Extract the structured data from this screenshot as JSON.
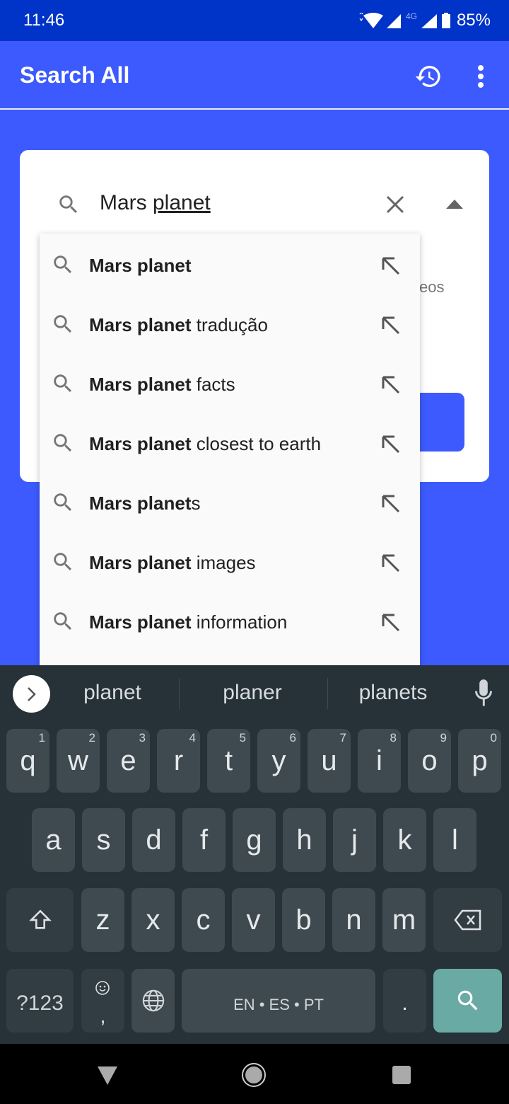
{
  "status_bar": {
    "time": "11:46",
    "network": "4G",
    "battery": "85%"
  },
  "app_bar": {
    "title": "Search All",
    "history_icon": "history-icon",
    "menu_icon": "more-vert-icon"
  },
  "search": {
    "query_plain": "Mars ",
    "query_composing": "planet",
    "clear_icon": "close-icon",
    "collapse_icon": "arrow-up-icon"
  },
  "card_partial_text": "eos",
  "suggestions": [
    {
      "bold": "Mars planet",
      "rest": ""
    },
    {
      "bold": "Mars planet",
      "rest": " tradução"
    },
    {
      "bold": "Mars planet",
      "rest": " facts"
    },
    {
      "bold": "Mars planet",
      "rest": " closest to earth"
    },
    {
      "bold": "Mars planet",
      "rest": "s"
    },
    {
      "bold": "Mars planet",
      "rest": " images"
    },
    {
      "bold": "Mars planet",
      "rest": " information"
    }
  ],
  "keyboard": {
    "word_suggestions": [
      "planet",
      "planer",
      "planets"
    ],
    "row1": [
      [
        "q",
        "1"
      ],
      [
        "w",
        "2"
      ],
      [
        "e",
        "3"
      ],
      [
        "r",
        "4"
      ],
      [
        "t",
        "5"
      ],
      [
        "y",
        "6"
      ],
      [
        "u",
        "7"
      ],
      [
        "i",
        "8"
      ],
      [
        "o",
        "9"
      ],
      [
        "p",
        "0"
      ]
    ],
    "row2": [
      "a",
      "s",
      "d",
      "f",
      "g",
      "h",
      "j",
      "k",
      "l"
    ],
    "row3": [
      "z",
      "x",
      "c",
      "v",
      "b",
      "n",
      "m"
    ],
    "symbols_label": "?123",
    "comma": ",",
    "space_label": "EN • ES • PT",
    "period": ".",
    "search_key_color": "#6aaaa5"
  },
  "colors": {
    "status_bar": "#0033c8",
    "app_bar": "#3d5afe",
    "keyboard": "#263238"
  }
}
